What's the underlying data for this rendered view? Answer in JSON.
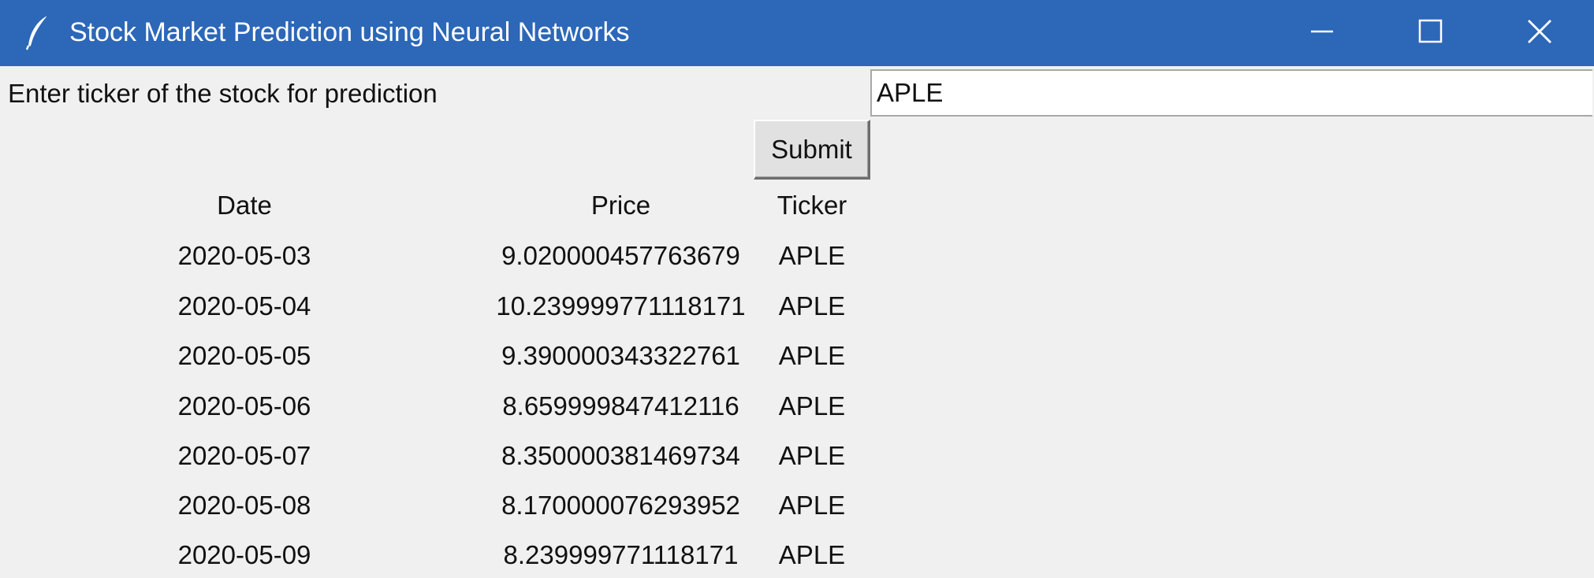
{
  "window": {
    "title": "Stock Market Prediction using Neural Networks",
    "icon": "feather-icon",
    "controls": [
      "minimize-icon",
      "maximize-icon",
      "close-icon"
    ],
    "titlebar_color": "#2c67b8"
  },
  "form": {
    "prompt_label": "Enter ticker of the stock for prediction",
    "ticker_value": "APLE",
    "submit_label": "Submit"
  },
  "table": {
    "headers": {
      "date": "Date",
      "price": "Price",
      "ticker": "Ticker"
    },
    "rows": [
      {
        "date": "2020-05-03",
        "price": "9.020000457763679",
        "ticker": "APLE"
      },
      {
        "date": "2020-05-04",
        "price": "10.239999771118171",
        "ticker": "APLE"
      },
      {
        "date": "2020-05-05",
        "price": "9.390000343322761",
        "ticker": "APLE"
      },
      {
        "date": "2020-05-06",
        "price": "8.659999847412116",
        "ticker": "APLE"
      },
      {
        "date": "2020-05-07",
        "price": "8.350000381469734",
        "ticker": "APLE"
      },
      {
        "date": "2020-05-08",
        "price": "8.170000076293952",
        "ticker": "APLE"
      },
      {
        "date": "2020-05-09",
        "price": "8.239999771118171",
        "ticker": "APLE"
      }
    ]
  }
}
